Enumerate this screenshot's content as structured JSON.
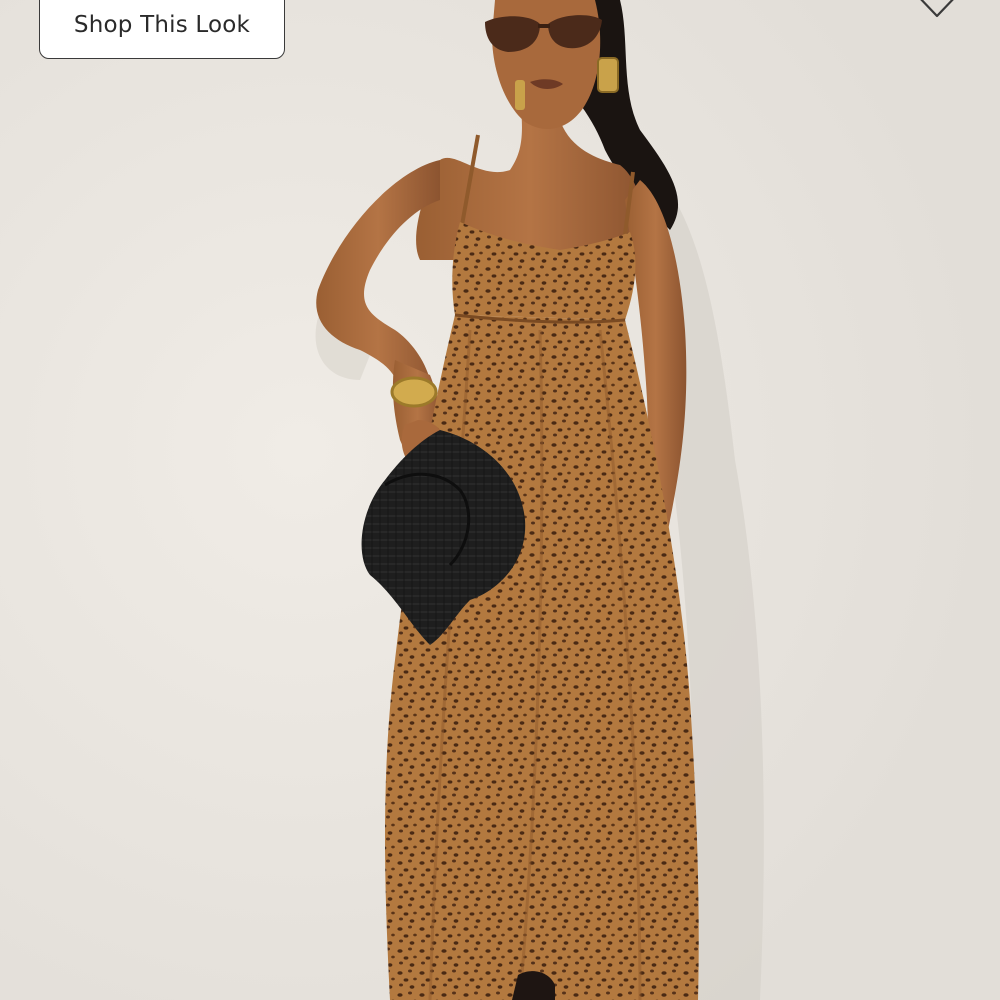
{
  "overlay": {
    "shop_button_label": "Shop This Look"
  },
  "icons": {
    "wishlist": "heart-outline-icon"
  },
  "colors": {
    "background": "#e9e5df",
    "button_border": "#3a3a3a",
    "dress": "#b07a45",
    "hat": "#202020"
  }
}
